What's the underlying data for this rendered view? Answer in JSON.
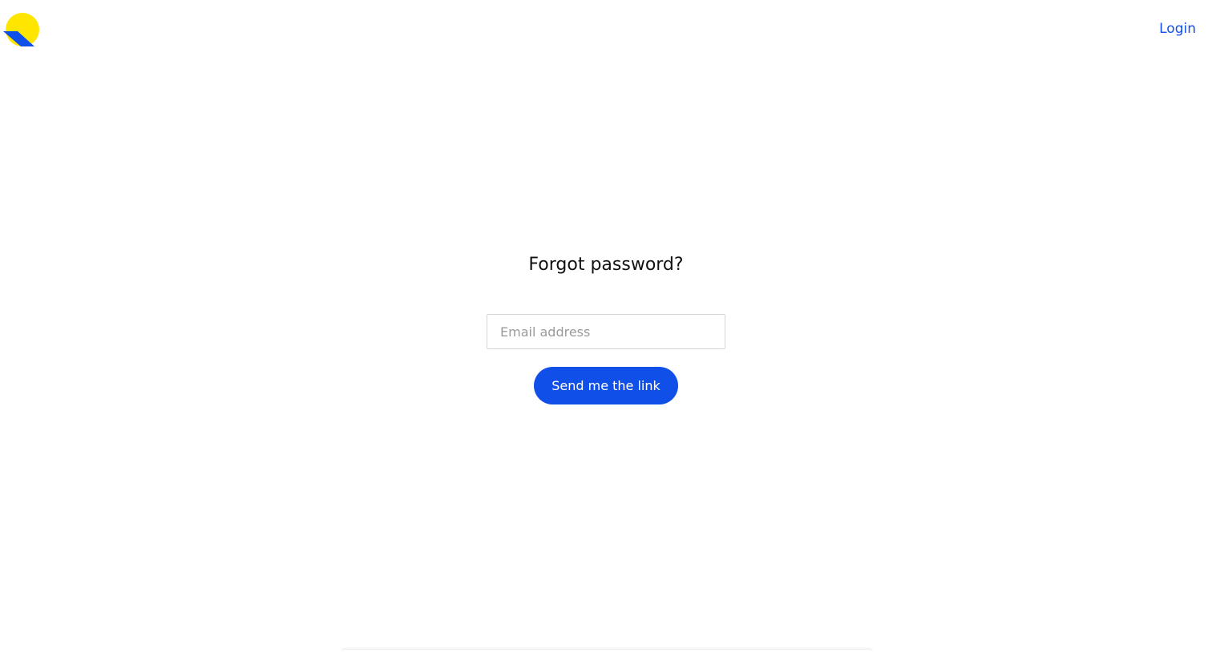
{
  "header": {
    "logo_icon": "sunrise-logo-icon",
    "login_label": "Login"
  },
  "form": {
    "title": "Forgot password?",
    "email_placeholder": "Email address",
    "email_value": "",
    "submit_label": "Send me the link"
  },
  "colors": {
    "accent": "#1150e8",
    "logo_yellow": "#ffe600",
    "logo_blue": "#1150e8"
  }
}
